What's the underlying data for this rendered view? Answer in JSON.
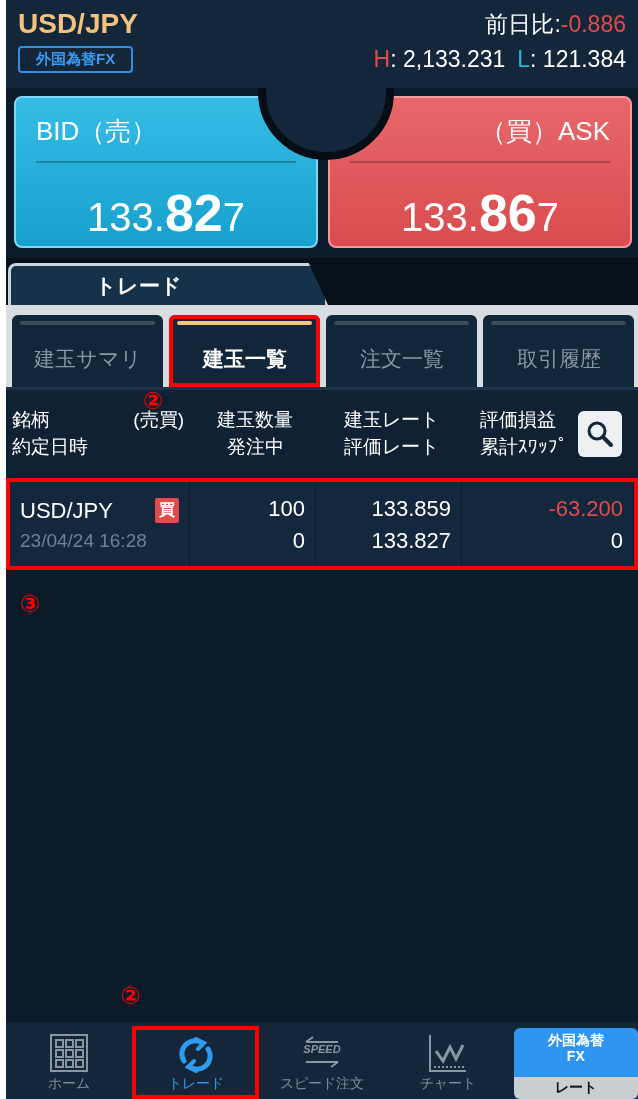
{
  "header": {
    "pair": "USD/JPY",
    "market_badge": "外国為替FX",
    "change_label": "前日比:",
    "change_value": "-0.886",
    "high_label": "H",
    "high_value": ": 2,133.231",
    "low_label": "L",
    "low_value": ": 121.384"
  },
  "quotes": [
    {
      "kind": "bid",
      "label": "BID（売）",
      "prefix": "133.",
      "big": "82",
      "suffix": "7"
    },
    {
      "kind": "ask",
      "label": "（買）ASK",
      "prefix": "133.",
      "big": "86",
      "suffix": "7"
    }
  ],
  "section_tab": "トレード",
  "tabs": [
    {
      "label": "建玉サマリ",
      "selected": false,
      "highlighted": false
    },
    {
      "label": "建玉一覧",
      "selected": true,
      "highlighted": true,
      "callout": "②"
    },
    {
      "label": "注文一覧",
      "selected": false,
      "highlighted": false
    },
    {
      "label": "取引履歴",
      "selected": false,
      "highlighted": false
    }
  ],
  "table": {
    "columns": [
      [
        "銘柄",
        "(売買)",
        "約定日時"
      ],
      [
        "建玉数量",
        "発注中"
      ],
      [
        "建玉レート",
        "評価レート"
      ],
      [
        "評価損益",
        "累計ｽﾜｯﾌﾟ"
      ]
    ],
    "rows": [
      {
        "pair": "USD/JPY",
        "side": "買",
        "date": "23/04/24 16:28",
        "quantity": "100",
        "pending": "0",
        "open_rate": "133.859",
        "eval_rate": "133.827",
        "pl": "-63.200",
        "pl_negative": true,
        "swap": "0",
        "highlighted": true,
        "callout": "③"
      }
    ]
  },
  "nav": [
    {
      "kind": "home",
      "label": "ホーム",
      "selected": false,
      "highlighted": false
    },
    {
      "kind": "trade",
      "label": "トレード",
      "selected": true,
      "highlighted": true,
      "callout": "②"
    },
    {
      "kind": "speed",
      "label": "スピード注文",
      "icon_text": "SPEED",
      "selected": false,
      "highlighted": false
    },
    {
      "kind": "chart",
      "label": "チャート",
      "selected": false,
      "highlighted": false
    },
    {
      "kind": "rate",
      "top": "外国為替\nFX",
      "label": "レート",
      "selected": false,
      "highlighted": false
    }
  ]
}
